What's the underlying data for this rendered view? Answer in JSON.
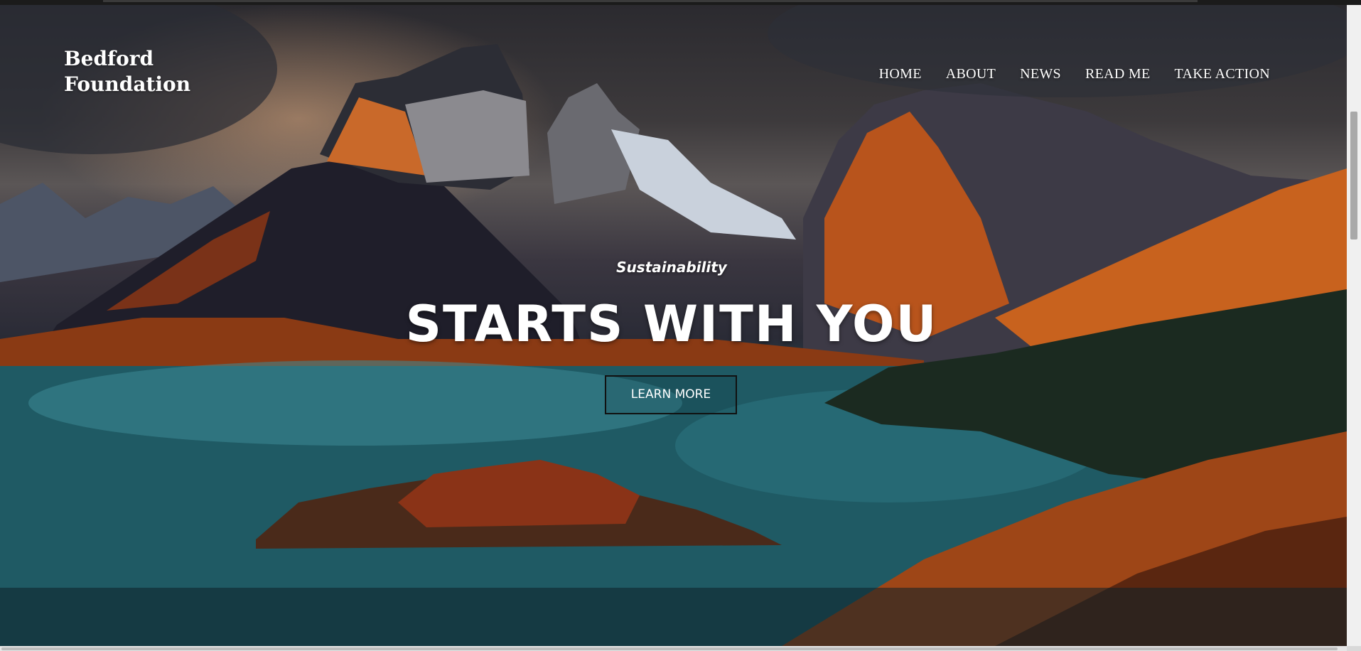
{
  "site": {
    "logo_line1": "Bedford",
    "logo_line2": "Foundation"
  },
  "nav": {
    "items": [
      {
        "label": "HOME"
      },
      {
        "label": "ABOUT"
      },
      {
        "label": "NEWS"
      },
      {
        "label": "READ ME"
      },
      {
        "label": "TAKE ACTION"
      }
    ]
  },
  "hero": {
    "tagline": "Sustainability",
    "headline": "STARTS WITH YOU",
    "cta_label": "LEARN MORE",
    "background": "mountain-lake-landscape-image"
  },
  "colors": {
    "text": "#ffffff",
    "cta_border": "#111111",
    "lake": "#1e5b66",
    "ridge_orange": "#c8621e"
  }
}
